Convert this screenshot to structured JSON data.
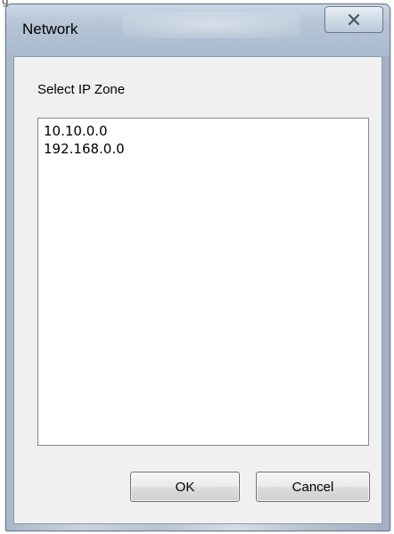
{
  "stray_glyph": "g",
  "window": {
    "title": "Network",
    "close_icon": "close-x-icon"
  },
  "dialog": {
    "prompt": "Select IP Zone",
    "ip_zones": [
      "10.10.0.0",
      "192.168.0.0"
    ]
  },
  "buttons": {
    "ok_label": "OK",
    "cancel_label": "Cancel"
  },
  "colors": {
    "titlebar": "#b4c4d5",
    "client_background": "#f0f0f0",
    "listbox_background": "#ffffff"
  }
}
